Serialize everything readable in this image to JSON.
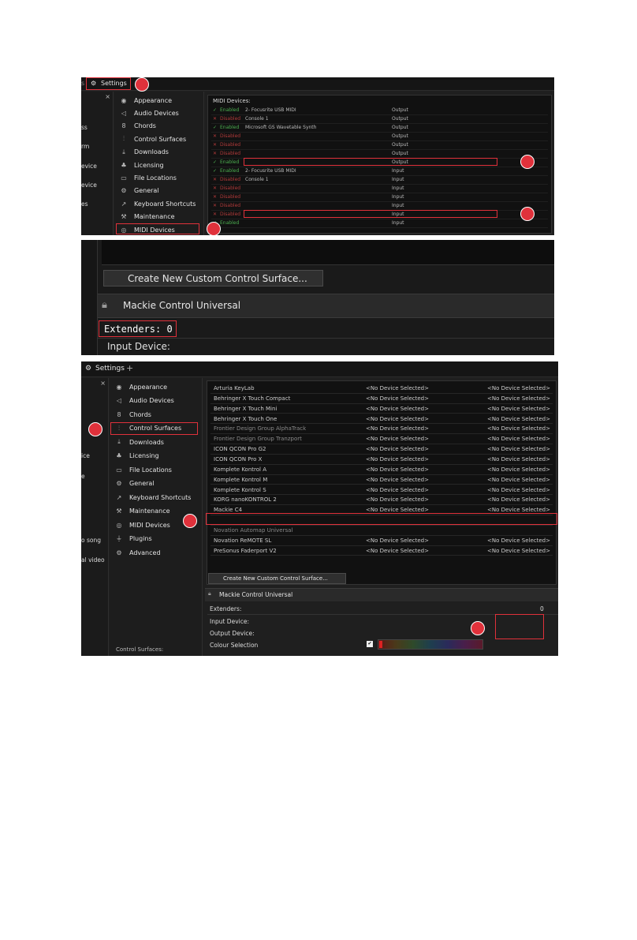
{
  "panel1": {
    "tab_label": "Settings",
    "left_stub_labels": [
      "ss",
      "rm",
      "evice",
      "evice",
      "es"
    ],
    "close_glyph": "×",
    "nav": [
      {
        "icon": "eye-icon",
        "glyph": "◉",
        "label": "Appearance"
      },
      {
        "icon": "speaker-icon",
        "glyph": "◁",
        "label": "Audio Devices"
      },
      {
        "icon": "chords-icon",
        "glyph": "8",
        "label": "Chords"
      },
      {
        "icon": "sliders-icon",
        "glyph": "⫶",
        "label": "Control Surfaces"
      },
      {
        "icon": "download-icon",
        "glyph": "⤓",
        "label": "Downloads"
      },
      {
        "icon": "licensing-icon",
        "glyph": "♣",
        "label": "Licensing"
      },
      {
        "icon": "folder-icon",
        "glyph": "▭",
        "label": "File Locations"
      },
      {
        "icon": "gear-icon",
        "glyph": "⚙",
        "label": "General"
      },
      {
        "icon": "external-link-icon",
        "glyph": "↗",
        "label": "Keyboard Shortcuts"
      },
      {
        "icon": "wrench-icon",
        "glyph": "⚒",
        "label": "Maintenance"
      },
      {
        "icon": "midi-icon",
        "glyph": "◎",
        "label": "MIDI Devices"
      }
    ],
    "section_title": "MIDI Devices:",
    "devices": [
      {
        "status": "Enabled",
        "enabled": true,
        "name": "2- Focusrite USB MIDI",
        "direction": "Output"
      },
      {
        "status": "Disabled",
        "enabled": false,
        "name": "Console 1",
        "direction": "Output"
      },
      {
        "status": "Enabled",
        "enabled": true,
        "name": "Microsoft GS Wavetable Synth",
        "direction": "Output"
      },
      {
        "status": "Disabled",
        "enabled": false,
        "name": "",
        "direction": "Output"
      },
      {
        "status": "Disabled",
        "enabled": false,
        "name": "",
        "direction": "Output"
      },
      {
        "status": "Disabled",
        "enabled": false,
        "name": "",
        "direction": "Output"
      },
      {
        "status": "Enabled",
        "enabled": true,
        "name": "",
        "direction": "Output"
      },
      {
        "status": "Enabled",
        "enabled": true,
        "name": "2- Focusrite USB MIDI",
        "direction": "Input"
      },
      {
        "status": "Disabled",
        "enabled": false,
        "name": "Console 1",
        "direction": "Input"
      },
      {
        "status": "Disabled",
        "enabled": false,
        "name": "",
        "direction": "Input"
      },
      {
        "status": "Disabled",
        "enabled": false,
        "name": "",
        "direction": "Input"
      },
      {
        "status": "Disabled",
        "enabled": false,
        "name": "",
        "direction": "Input"
      },
      {
        "status": "Disabled",
        "enabled": false,
        "name": "",
        "direction": "Input"
      },
      {
        "status": "Enabled",
        "enabled": true,
        "name": "",
        "direction": "Input"
      }
    ]
  },
  "panel2": {
    "create_button": "Create New Custom Control Surface...",
    "surface_name": "Mackie Control Universal",
    "extenders": "Extenders: 0",
    "input_device": "Input Device:"
  },
  "panel3": {
    "tab_label": "Settings",
    "add_tab": "+",
    "close_glyph": "×",
    "left_stub_labels": [
      "ice",
      "e",
      "o song",
      "al video"
    ],
    "nav": [
      {
        "icon": "eye-icon",
        "glyph": "◉",
        "label": "Appearance"
      },
      {
        "icon": "speaker-icon",
        "glyph": "◁",
        "label": "Audio Devices"
      },
      {
        "icon": "chords-icon",
        "glyph": "8",
        "label": "Chords"
      },
      {
        "icon": "sliders-icon",
        "glyph": "⫶",
        "label": "Control Surfaces"
      },
      {
        "icon": "download-icon",
        "glyph": "⤓",
        "label": "Downloads"
      },
      {
        "icon": "licensing-icon",
        "glyph": "♣",
        "label": "Licensing"
      },
      {
        "icon": "folder-icon",
        "glyph": "▭",
        "label": "File Locations"
      },
      {
        "icon": "gear-icon",
        "glyph": "⚙",
        "label": "General"
      },
      {
        "icon": "external-link-icon",
        "glyph": "↗",
        "label": "Keyboard Shortcuts"
      },
      {
        "icon": "wrench-icon",
        "glyph": "⚒",
        "label": "Maintenance"
      },
      {
        "icon": "midi-icon",
        "glyph": "◎",
        "label": "MIDI Devices"
      },
      {
        "icon": "plug-icon",
        "glyph": "⏚",
        "label": "Plugins"
      },
      {
        "icon": "gear-icon",
        "glyph": "⚙",
        "label": "Advanced"
      }
    ],
    "footer_label": "Control Surfaces:",
    "surfaces": [
      {
        "name": "Arturia KeyLab",
        "input": "<No Device Selected>",
        "output": "<No Device Selected>"
      },
      {
        "name": "Behringer X Touch Compact",
        "input": "<No Device Selected>",
        "output": "<No Device Selected>"
      },
      {
        "name": "Behringer X Touch Mini",
        "input": "<No Device Selected>",
        "output": "<No Device Selected>"
      },
      {
        "name": "Behringer X Touch One",
        "input": "<No Device Selected>",
        "output": "<No Device Selected>"
      },
      {
        "name": "Frontier Design Group AlphaTrack",
        "input": "<No Device Selected>",
        "output": "<No Device Selected>"
      },
      {
        "name": "Frontier Design Group Tranzport",
        "input": "<No Device Selected>",
        "output": "<No Device Selected>"
      },
      {
        "name": "ICON QCON Pro G2",
        "input": "<No Device Selected>",
        "output": "<No Device Selected>"
      },
      {
        "name": "ICON QCON Pro X",
        "input": "<No Device Selected>",
        "output": "<No Device Selected>"
      },
      {
        "name": "Komplete Kontrol A",
        "input": "<No Device Selected>",
        "output": "<No Device Selected>"
      },
      {
        "name": "Komplete Kontrol M",
        "input": "<No Device Selected>",
        "output": "<No Device Selected>"
      },
      {
        "name": "Komplete Kontrol S",
        "input": "<No Device Selected>",
        "output": "<No Device Selected>"
      },
      {
        "name": "KORG nanoKONTROL 2",
        "input": "<No Device Selected>",
        "output": "<No Device Selected>"
      },
      {
        "name": "Mackie C4",
        "input": "<No Device Selected>",
        "output": "<No Device Selected>"
      },
      {
        "name": "",
        "input": "",
        "output": ""
      },
      {
        "name": "Novation Automap Universal",
        "input": "",
        "output": ""
      },
      {
        "name": "Novation ReMOTE SL",
        "input": "<No Device Selected>",
        "output": "<No Device Selected>"
      },
      {
        "name": "PreSonus Faderport V2",
        "input": "<No Device Selected>",
        "output": "<No Device Selected>"
      }
    ],
    "create_button": "Create New Custom Control Surface...",
    "surface_name": "Mackie Control Universal",
    "extenders_label": "Extenders:",
    "extenders_value": "0",
    "input_device_label": "Input Device:",
    "output_device_label": "Output Device:",
    "colour_label": "Colour Selection",
    "checkbox_glyph": "✔"
  },
  "colors": {
    "highlight": "#e0313b",
    "enabled": "#4caf50",
    "disabled": "#b13a3a",
    "panel_bg": "#1f1f1f",
    "content_bg": "#111111"
  }
}
